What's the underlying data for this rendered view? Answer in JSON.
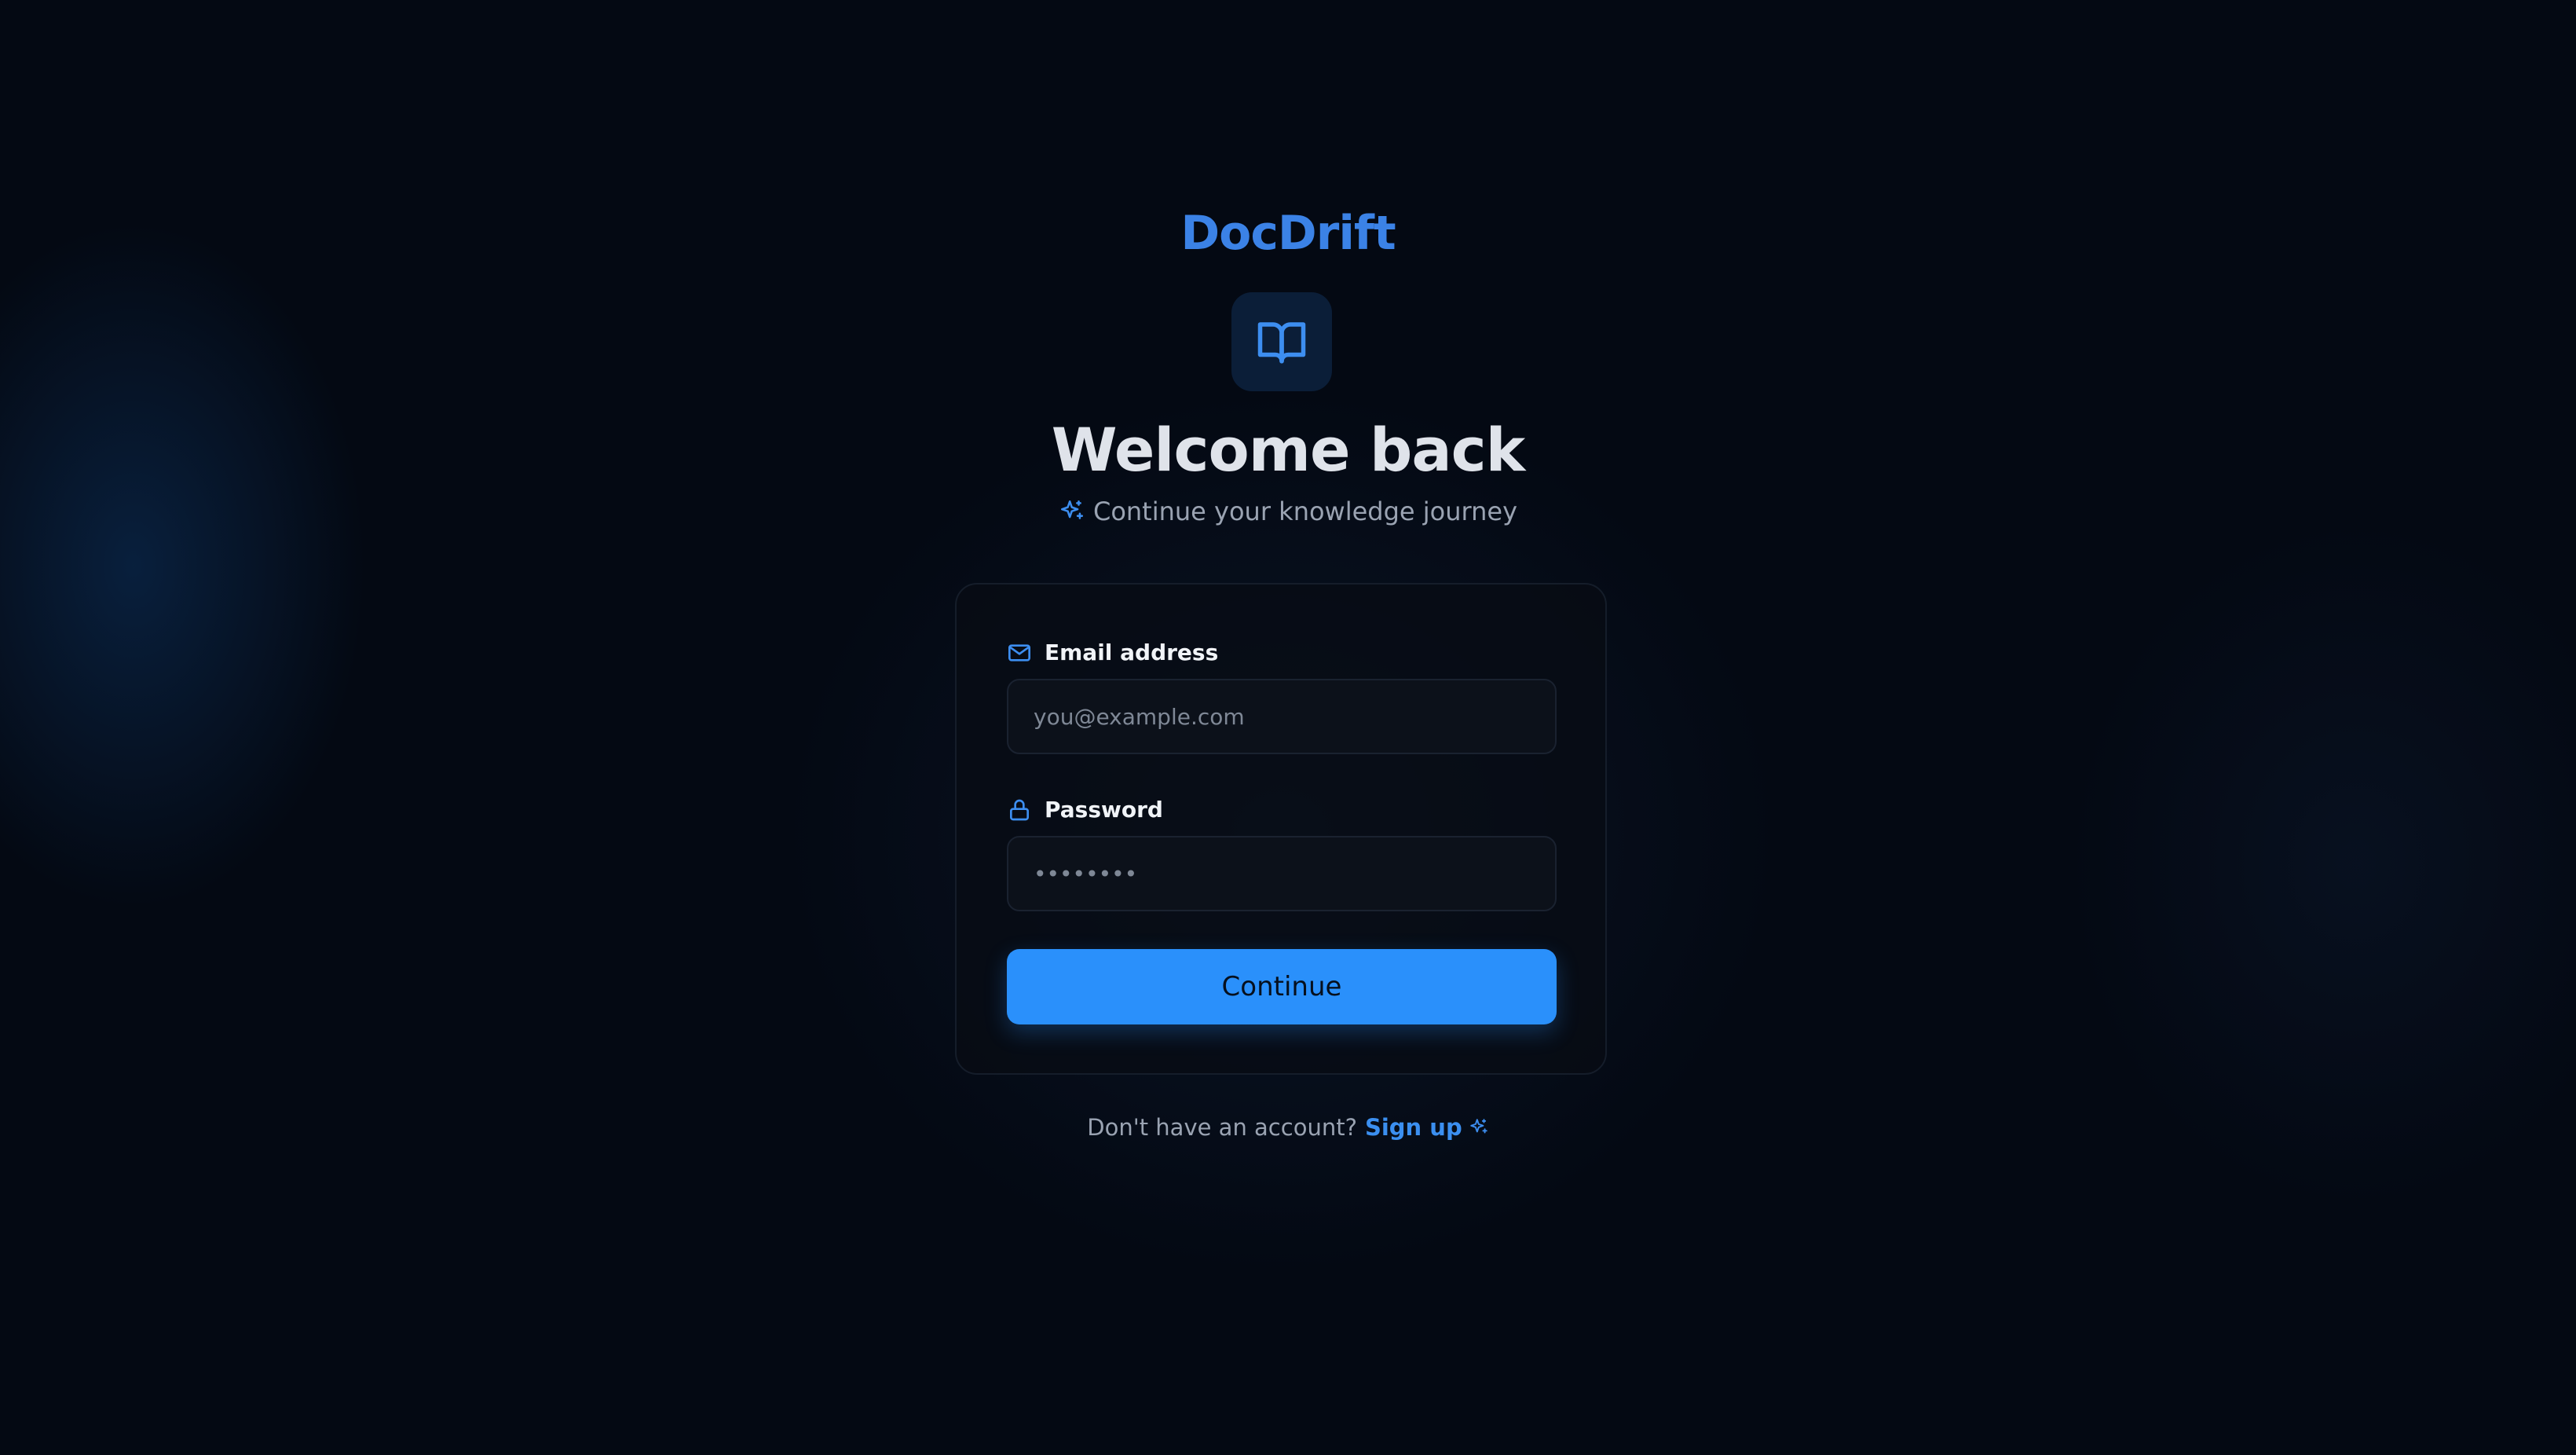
{
  "app": {
    "brand": "DocDrift",
    "logo_icon": "book-open-icon",
    "accent_color": "#2a90fb",
    "brand_color": "#3b82e6"
  },
  "header": {
    "title": "Welcome back",
    "subtitle": "Continue your knowledge journey",
    "subtitle_icon": "sparkles-icon"
  },
  "form": {
    "email": {
      "label": "Email address",
      "icon": "mail-icon",
      "placeholder": "you@example.com",
      "value": ""
    },
    "password": {
      "label": "Password",
      "icon": "lock-icon",
      "placeholder": "••••••••",
      "value": ""
    },
    "submit_label": "Continue"
  },
  "footer": {
    "prompt": "Don't have an account?",
    "signup_label": "Sign up",
    "signup_icon": "sparkles-icon"
  }
}
